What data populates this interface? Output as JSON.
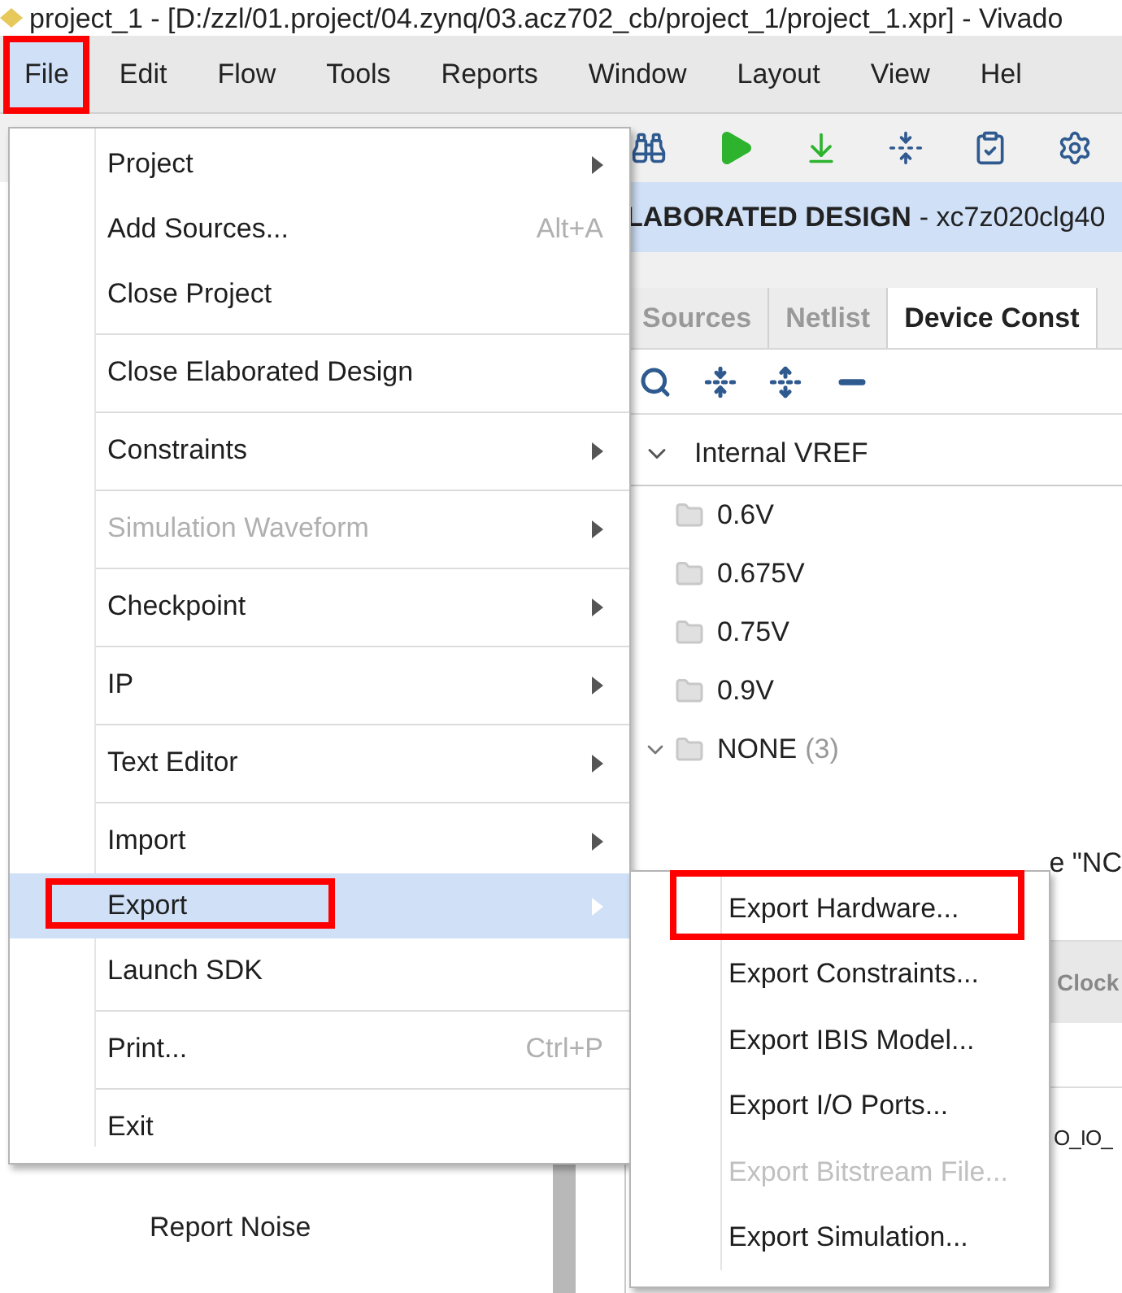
{
  "window": {
    "title": "project_1 - [D:/zzl/01.project/04.zynq/03.acz702_cb/project_1/project_1.xpr] - Vivado"
  },
  "menubar": [
    {
      "label": "File",
      "selected": true,
      "annotated": true
    },
    {
      "label": "Edit",
      "selected": false,
      "annotated": false
    },
    {
      "label": "Flow",
      "selected": false,
      "annotated": false
    },
    {
      "label": "Tools",
      "selected": false,
      "annotated": false
    },
    {
      "label": "Reports",
      "selected": false,
      "annotated": false
    },
    {
      "label": "Window",
      "selected": false,
      "annotated": false
    },
    {
      "label": "Layout",
      "selected": false,
      "annotated": false
    },
    {
      "label": "View",
      "selected": false,
      "annotated": false
    },
    {
      "label": "Hel",
      "selected": false,
      "annotated": false
    }
  ],
  "design_header": {
    "title": "LABORATED DESIGN",
    "part": "- xc7z020clg40"
  },
  "panel_tabs": [
    {
      "label": "Sources",
      "selected": false
    },
    {
      "label": "Netlist",
      "selected": false
    },
    {
      "label": "Device Const",
      "selected": true
    }
  ],
  "tree": [
    {
      "label": "Internal VREF",
      "expanded": true,
      "children": [
        {
          "label": "0.6V"
        },
        {
          "label": "0.675V"
        },
        {
          "label": "0.75V"
        },
        {
          "label": "0.9V"
        },
        {
          "label": "NONE",
          "count": "(3)",
          "expanded": true
        }
      ]
    }
  ],
  "fragments": {
    "row_text": "e \"NC",
    "tab_text": "Clock",
    "cell_text": "O_IO_"
  },
  "left_panel": {
    "item": "Report Noise"
  },
  "file_menu": {
    "items": [
      {
        "kind": "item",
        "label": "Project",
        "submenu": true,
        "disabled": false,
        "selected": false,
        "annotated": false
      },
      {
        "kind": "item",
        "label": "Add Sources...",
        "shortcut": "Alt+A",
        "submenu": false,
        "disabled": false,
        "selected": false,
        "annotated": false
      },
      {
        "kind": "item",
        "label": "Close Project",
        "submenu": false,
        "disabled": false,
        "selected": false,
        "annotated": false
      },
      {
        "kind": "separator"
      },
      {
        "kind": "item",
        "label": "Close Elaborated Design",
        "submenu": false,
        "disabled": false,
        "selected": false,
        "annotated": false
      },
      {
        "kind": "separator"
      },
      {
        "kind": "item",
        "label": "Constraints",
        "submenu": true,
        "disabled": false,
        "selected": false,
        "annotated": false
      },
      {
        "kind": "separator"
      },
      {
        "kind": "item",
        "label": "Simulation Waveform",
        "submenu": true,
        "disabled": true,
        "selected": false,
        "annotated": false
      },
      {
        "kind": "separator"
      },
      {
        "kind": "item",
        "label": "Checkpoint",
        "submenu": true,
        "disabled": false,
        "selected": false,
        "annotated": false
      },
      {
        "kind": "separator"
      },
      {
        "kind": "item",
        "label": "IP",
        "submenu": true,
        "disabled": false,
        "selected": false,
        "annotated": false
      },
      {
        "kind": "separator"
      },
      {
        "kind": "item",
        "label": "Text Editor",
        "submenu": true,
        "disabled": false,
        "selected": false,
        "annotated": false
      },
      {
        "kind": "separator"
      },
      {
        "kind": "item",
        "label": "Import",
        "submenu": true,
        "disabled": false,
        "selected": false,
        "annotated": false
      },
      {
        "kind": "item",
        "label": "Export",
        "submenu": true,
        "disabled": false,
        "selected": true,
        "annotated": true
      },
      {
        "kind": "item",
        "label": "Launch SDK",
        "submenu": false,
        "disabled": false,
        "selected": false,
        "annotated": false
      },
      {
        "kind": "separator"
      },
      {
        "kind": "item",
        "label": "Print...",
        "shortcut": "Ctrl+P",
        "submenu": false,
        "disabled": false,
        "selected": false,
        "annotated": false
      },
      {
        "kind": "separator"
      },
      {
        "kind": "item",
        "label": "Exit",
        "submenu": false,
        "disabled": false,
        "selected": false,
        "annotated": false
      }
    ]
  },
  "export_menu": {
    "items": [
      {
        "label": "Export Hardware...",
        "disabled": false,
        "annotated": true
      },
      {
        "label": "Export Constraints...",
        "disabled": false,
        "annotated": false
      },
      {
        "label": "Export IBIS Model...",
        "disabled": false,
        "annotated": false
      },
      {
        "label": "Export I/O Ports...",
        "disabled": false,
        "annotated": false
      },
      {
        "label": "Export Bitstream File...",
        "disabled": true,
        "annotated": false
      },
      {
        "label": "Export Simulation...",
        "disabled": false,
        "annotated": false
      }
    ]
  }
}
